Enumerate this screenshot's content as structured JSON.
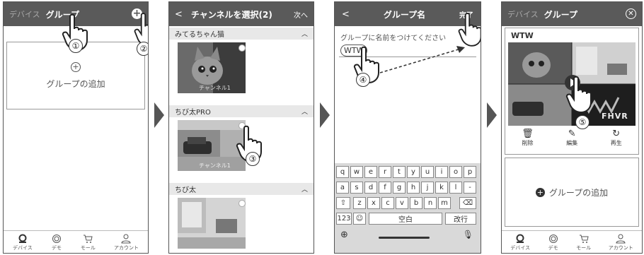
{
  "panel1": {
    "header_dim": "デバイス",
    "header_title": "グループ",
    "add_group_label": "グループの追加",
    "tabs": [
      "デバイス",
      "デモ",
      "モール",
      "アカウント"
    ],
    "step_a": "①",
    "step_b": "②"
  },
  "panel2": {
    "back": "<",
    "title": "チャンネルを選択(2)",
    "next": "次へ",
    "channels": [
      {
        "name": "みてるちゃん猫",
        "overlay": "チャンネル1"
      },
      {
        "name": "ちび太PRO",
        "overlay": "チャンネル1"
      },
      {
        "name": "ちび太",
        "overlay": ""
      }
    ],
    "step": "③"
  },
  "panel3": {
    "back": "<",
    "title": "グループ名",
    "done": "完了",
    "placeholder": "グループに名前をつけてください",
    "value": "WTW",
    "row1": [
      "q",
      "w",
      "e",
      "r",
      "t",
      "y",
      "u",
      "i",
      "o",
      "p"
    ],
    "row2": [
      "a",
      "s",
      "d",
      "f",
      "g",
      "h",
      "j",
      "k",
      "l",
      "-"
    ],
    "row3": [
      "z",
      "x",
      "c",
      "v",
      "b",
      "n",
      "m"
    ],
    "key_123": "123",
    "key_space": "空白",
    "key_return": "改行",
    "step": "④"
  },
  "panel4": {
    "header_dim": "デバイス",
    "header_title": "グループ",
    "group_name": "WTW",
    "actions": [
      "削除",
      "編集",
      "再生"
    ],
    "add_group_label": "グループの追加",
    "tabs": [
      "デバイス",
      "デモ",
      "モール",
      "アカウント"
    ],
    "logo_text": "FHVR",
    "step": "⑤"
  }
}
